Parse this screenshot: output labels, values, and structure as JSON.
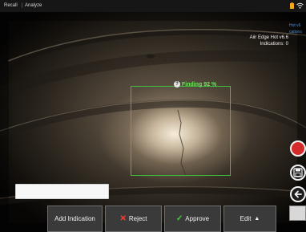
{
  "status_bar": {
    "menu": [
      {
        "label": "Recall"
      },
      {
        "label": "Analyze"
      }
    ],
    "separator": "|",
    "icons": [
      "battery-icon",
      "wifi-icon"
    ]
  },
  "model_info": {
    "model_line": "Aiir Edge Hot v6.6",
    "indications_label": "Indications:",
    "indications_count": "0",
    "side_link_1": "Hot v6",
    "side_link_2": "cations"
  },
  "finding": {
    "label": "Finding",
    "confidence": "92 %",
    "help_glyph": "?",
    "color": "#3fbf3f"
  },
  "note_field": {
    "value": ""
  },
  "actions": {
    "add_indication": "Add Indication",
    "reject": "Reject",
    "approve": "Approve",
    "edit": "Edit",
    "reject_color": "#ff3b30",
    "approve_color": "#3fd33a"
  },
  "side_controls": [
    "record-button",
    "save-icon",
    "back-arrow-icon",
    "panel-tab"
  ]
}
